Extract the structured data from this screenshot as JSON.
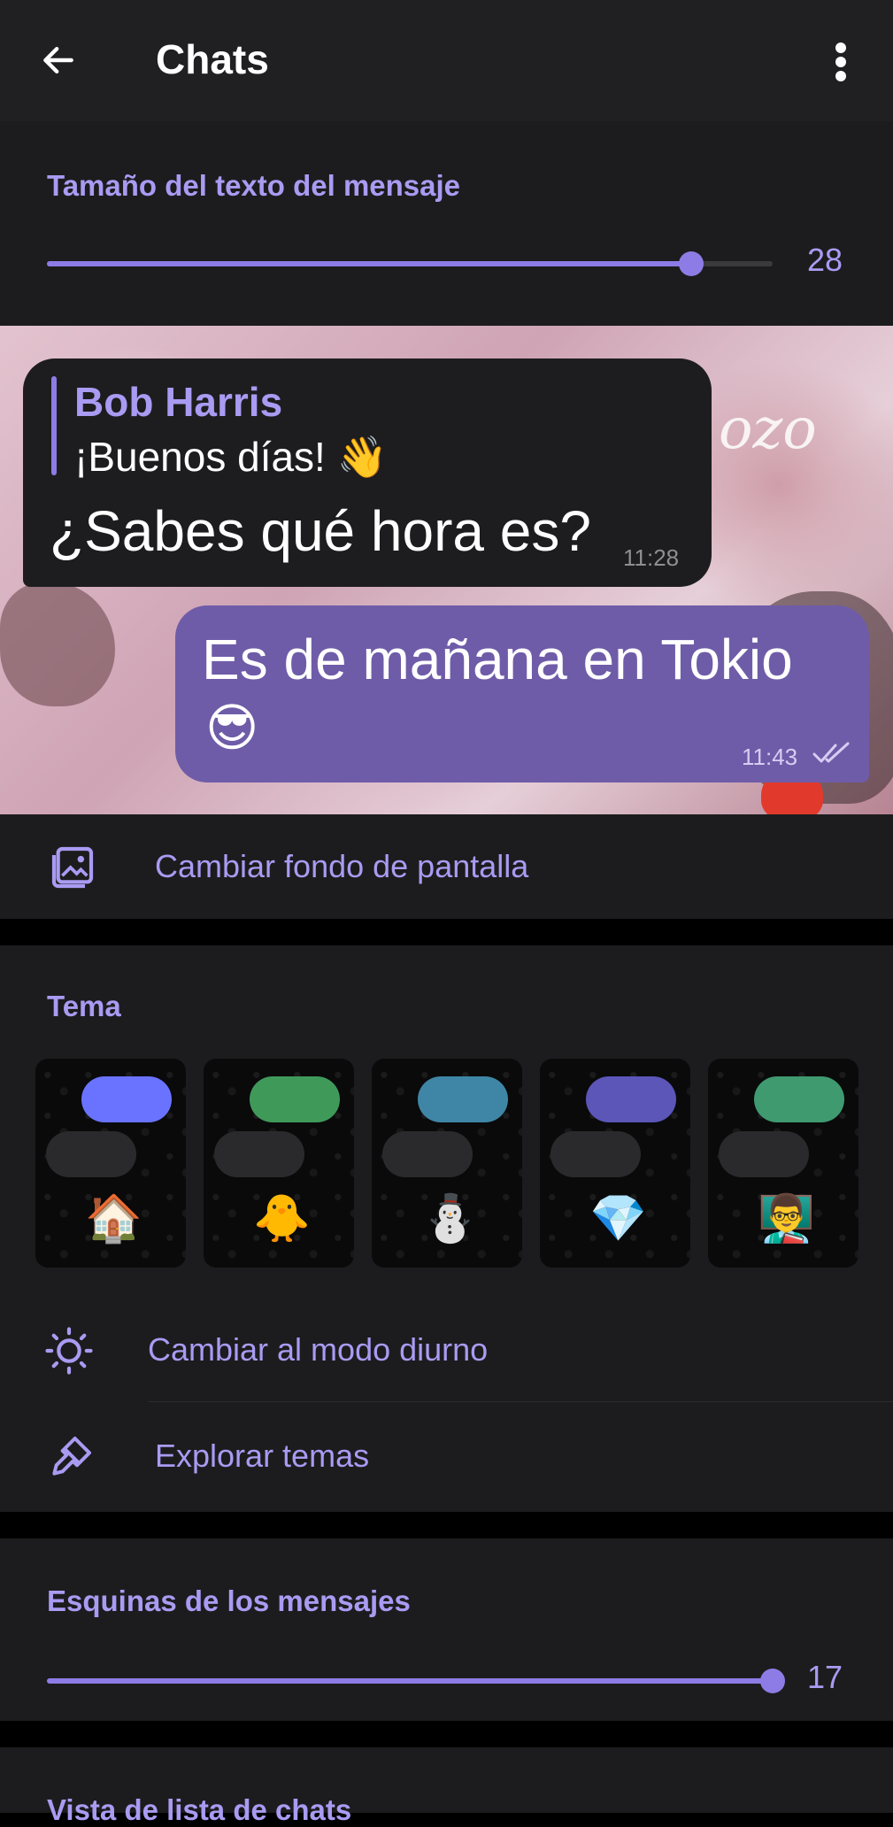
{
  "appbar": {
    "title": "Chats",
    "back_icon": "arrow-left-icon",
    "menu_icon": "more-vertical-icon"
  },
  "text_size": {
    "title": "Tamaño del texto del mensaje",
    "value": "28",
    "fraction": 0.888
  },
  "preview": {
    "watermark": "ozo",
    "incoming": {
      "reply_name": "Bob Harris",
      "reply_text": "¡Buenos días! 👋",
      "message": "¿Sabes qué hora es?",
      "time": "11:28"
    },
    "outgoing": {
      "message": "Es de mañana en Tokio",
      "emoji": "😎",
      "time": "11:43"
    }
  },
  "wallpaper": {
    "label": "Cambiar fondo de pantalla",
    "icon": "wallpaper-icon"
  },
  "theme": {
    "title": "Tema",
    "items": [
      {
        "emoji": "🏠",
        "accent": "#6a73ff"
      },
      {
        "emoji": "🐥",
        "accent": "#3f9a5a"
      },
      {
        "emoji": "⛄",
        "accent": "#3f86a6"
      },
      {
        "emoji": "💎",
        "accent": "#5b56b7"
      },
      {
        "emoji": "👨‍🏫",
        "accent": "#3f9a6f"
      }
    ]
  },
  "day_mode": {
    "label": "Cambiar al modo diurno",
    "icon": "sun-icon"
  },
  "browse_themes": {
    "label": "Explorar temas",
    "icon": "brush-icon"
  },
  "corners": {
    "title": "Esquinas de los mensajes",
    "value": "17",
    "fraction": 1.0
  },
  "chat_list": {
    "title": "Vista de lista de chats"
  },
  "colors": {
    "accent": "#8d7ce6",
    "accent_text": "#a99bf2",
    "outgoing_bubble": "#6f5ca8",
    "surface": "#1c1c1e"
  }
}
